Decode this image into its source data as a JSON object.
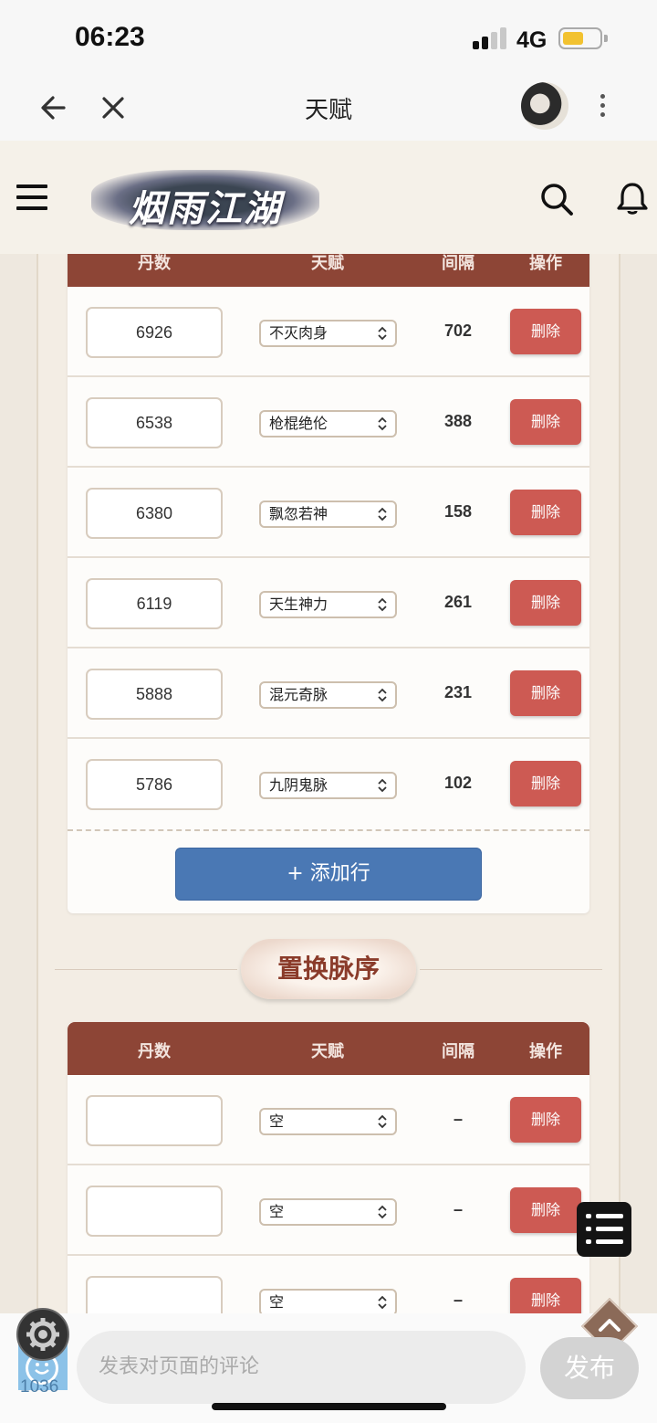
{
  "status": {
    "time": "06:23",
    "network": "4G"
  },
  "nav": {
    "title": "天赋"
  },
  "site": {
    "logo_text": "烟雨江湖"
  },
  "table1": {
    "headers": [
      "丹数",
      "天赋",
      "间隔",
      "操作"
    ],
    "rows": [
      {
        "dan": "6926",
        "talent": "不灭肉身",
        "gap": "702",
        "action": "删除"
      },
      {
        "dan": "6538",
        "talent": "枪棍绝伦",
        "gap": "388",
        "action": "删除"
      },
      {
        "dan": "6380",
        "talent": "飘忽若神",
        "gap": "158",
        "action": "删除"
      },
      {
        "dan": "6119",
        "talent": "天生神力",
        "gap": "261",
        "action": "删除"
      },
      {
        "dan": "5888",
        "talent": "混元奇脉",
        "gap": "231",
        "action": "删除"
      },
      {
        "dan": "5786",
        "talent": "九阴鬼脉",
        "gap": "102",
        "action": "删除"
      }
    ],
    "add_label": "+ 添加行"
  },
  "section2": {
    "title": "置换脉序"
  },
  "table2": {
    "headers": [
      "丹数",
      "天赋",
      "间隔",
      "操作"
    ],
    "rows": [
      {
        "dan": "",
        "talent": "空",
        "gap": "–",
        "action": "删除"
      },
      {
        "dan": "",
        "talent": "空",
        "gap": "–",
        "action": "删除"
      },
      {
        "dan": "",
        "talent": "空",
        "gap": "–",
        "action": "删除"
      }
    ]
  },
  "comment": {
    "placeholder": "发表对页面的评论",
    "publish": "发布",
    "count": "1036"
  },
  "colors": {
    "header_brown": "#8d4536",
    "delete_red": "#cd5a53",
    "add_blue": "#4a78b4"
  }
}
